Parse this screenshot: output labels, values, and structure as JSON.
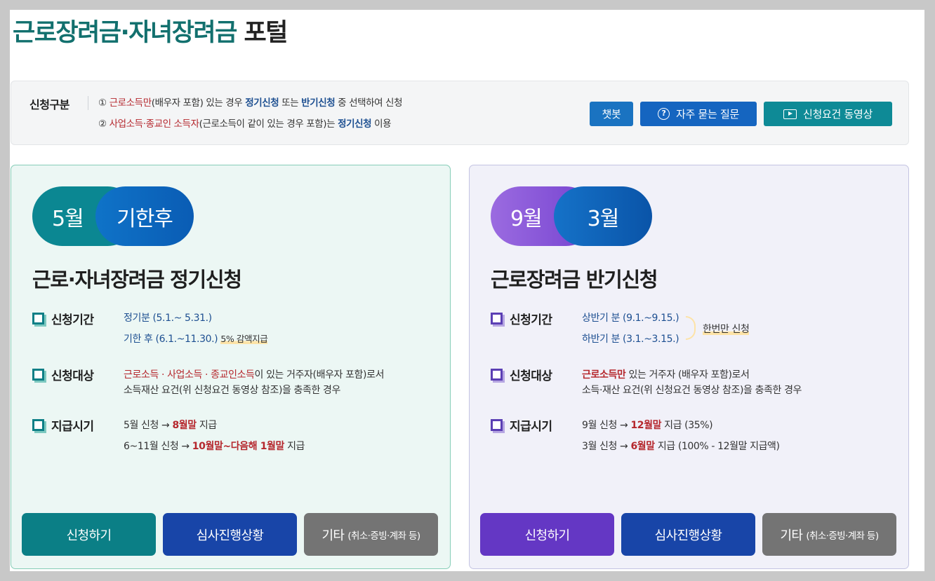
{
  "header": {
    "title_main": "근로장려금·자녀장려금",
    "title_suffix": "포털"
  },
  "notice": {
    "label": "신청구분",
    "line1": {
      "num": "①",
      "a": "근로소득만",
      "b": "(배우자 포함) 있는 경우",
      "c": "정기신청",
      "d": "또는",
      "e": "반기신청",
      "f": "중 선택하여 신청"
    },
    "line2": {
      "num": "②",
      "a": "사업소득·종교인 소득자",
      "b": "(근로소득이 같이 있는 경우 포함)는",
      "c": "정기신청",
      "d": "이용"
    },
    "buttons": {
      "chatbot": "챗봇",
      "faq": "자주 묻는 질문",
      "video": "신청요건 동영상"
    }
  },
  "left_card": {
    "pill_a": "5월",
    "pill_b": "기한후",
    "title": "근로·자녀장려금 정기신청",
    "period_label": "신청기간",
    "period_1": "정기분 (5.1.~ 5.31.)",
    "period_2": "기한 후 (6.1.~11.30.)",
    "period_2_note": "5% 감액지급",
    "target_label": "신청대상",
    "target_red": "근로소득 · 사업소득 · 종교인소득",
    "target_rest": "이 있는 거주자(배우자 포함)로서",
    "target_line2": "소득재산 요건(위 신청요건 동영상 참조)을 충족한 경우",
    "pay_label": "지급시기",
    "pay_1_pre": "5월 신청 →",
    "pay_1_red": "8월말",
    "pay_1_post": "지급",
    "pay_2_pre": "6~11월 신청 →",
    "pay_2_red1": "10월말",
    "pay_2_mid": "~",
    "pay_2_red2": "다음해 1월말",
    "pay_2_post": "지급",
    "btn_apply": "신청하기",
    "btn_status": "심사진행상황",
    "btn_etc": "기타",
    "btn_etc_small": "(취소·증빙·계좌 등)"
  },
  "right_card": {
    "pill_a": "9월",
    "pill_b": "3월",
    "title": "근로장려금 반기신청",
    "period_label": "신청기간",
    "period_1": "상반기 분 (9.1.~9.15.)",
    "period_2": "하반기 분 (3.1.~3.15.)",
    "period_note": "한번만 신청",
    "target_label": "신청대상",
    "target_red": "근로소득만",
    "target_rest": "있는 거주자 (배우자 포함)로서",
    "target_line2": "소득·재산 요건(위 신청요건 동영상 참조)을 충족한 경우",
    "pay_label": "지급시기",
    "pay_1_pre": "9월 신청 →",
    "pay_1_red": "12월말",
    "pay_1_post": "지급 (35%)",
    "pay_2_pre": "3월 신청 →",
    "pay_2_red": "6월말",
    "pay_2_post": "지급 (100% - 12월말 지급액)",
    "btn_apply": "신청하기",
    "btn_status": "심사진행상황",
    "btn_etc": "기타",
    "btn_etc_small": "(취소·증빙·계좌 등)"
  },
  "colors": {
    "brand_green": "#12706e",
    "teal": "#0b7f86",
    "purple": "#6437c4",
    "navy": "#1845a8",
    "red": "#b5272d"
  }
}
